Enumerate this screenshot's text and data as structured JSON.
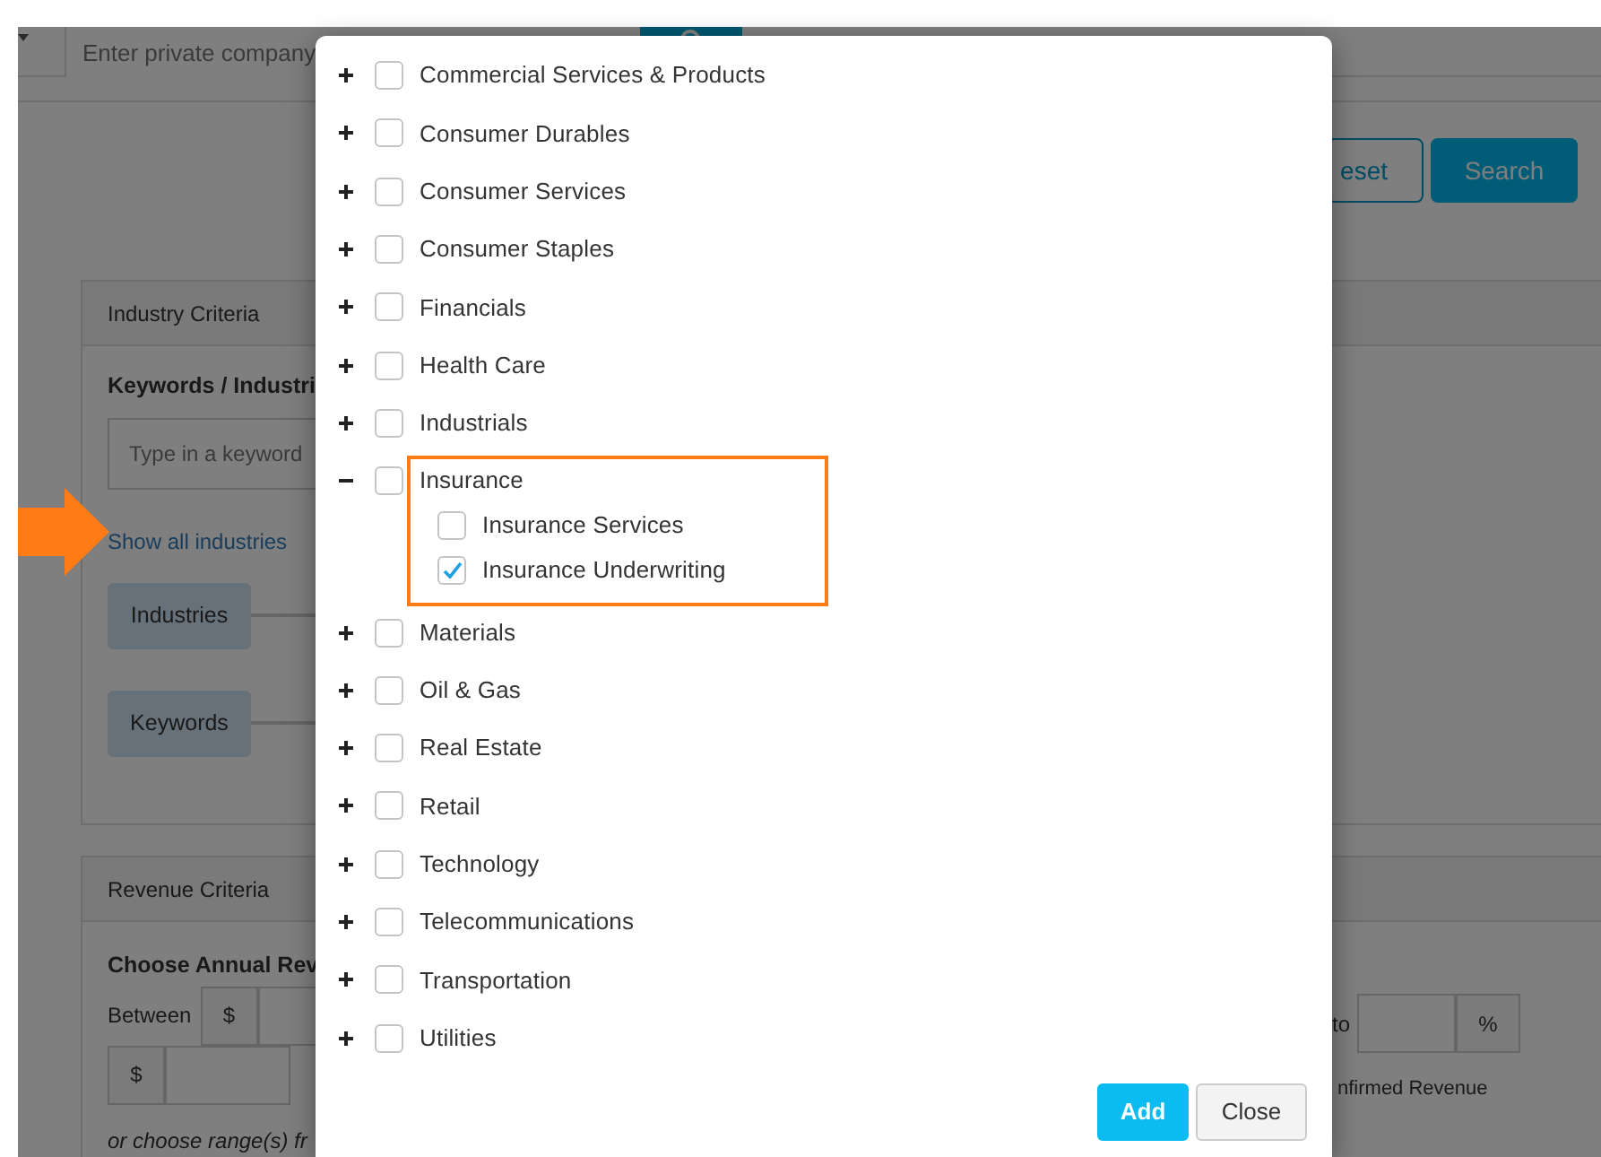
{
  "background": {
    "search_placeholder": "Enter private company",
    "reset_button": "eset",
    "search_button": "Search",
    "industry_panel": {
      "title": "Industry Criteria",
      "keywords_label": "Keywords / Industri",
      "keyword_placeholder": "Type in a keyword",
      "show_all_link": "Show all industries",
      "chips": [
        "Industries",
        "Keywords"
      ]
    },
    "revenue_panel": {
      "title": "Revenue Criteria",
      "choose_label": "Choose Annual Rev",
      "between_label": "Between",
      "currency": [
        "$",
        "$"
      ],
      "to_label": "to",
      "percent": "%",
      "note": "nfirmed Revenue",
      "range_text": "or choose range(s) fr"
    }
  },
  "modal": {
    "industries": [
      {
        "label": "Commercial Services & Products",
        "expanded": false,
        "checked": false
      },
      {
        "label": "Consumer Durables",
        "expanded": false,
        "checked": false
      },
      {
        "label": "Consumer Services",
        "expanded": false,
        "checked": false
      },
      {
        "label": "Consumer Staples",
        "expanded": false,
        "checked": false
      },
      {
        "label": "Financials",
        "expanded": false,
        "checked": false
      },
      {
        "label": "Health Care",
        "expanded": false,
        "checked": false
      },
      {
        "label": "Industrials",
        "expanded": false,
        "checked": false
      },
      {
        "label": "Insurance",
        "expanded": true,
        "checked": false,
        "children": [
          {
            "label": "Insurance Services",
            "checked": false
          },
          {
            "label": "Insurance Underwriting",
            "checked": true
          }
        ]
      },
      {
        "label": "Materials",
        "expanded": false,
        "checked": false
      },
      {
        "label": "Oil & Gas",
        "expanded": false,
        "checked": false
      },
      {
        "label": "Real Estate",
        "expanded": false,
        "checked": false
      },
      {
        "label": "Retail",
        "expanded": false,
        "checked": false
      },
      {
        "label": "Technology",
        "expanded": false,
        "checked": false
      },
      {
        "label": "Telecommunications",
        "expanded": false,
        "checked": false
      },
      {
        "label": "Transportation",
        "expanded": false,
        "checked": false
      },
      {
        "label": "Utilities",
        "expanded": false,
        "checked": false
      }
    ],
    "buttons": [
      {
        "label": "Add",
        "kind": "primary"
      },
      {
        "label": "Close",
        "kind": "secondary"
      }
    ]
  }
}
